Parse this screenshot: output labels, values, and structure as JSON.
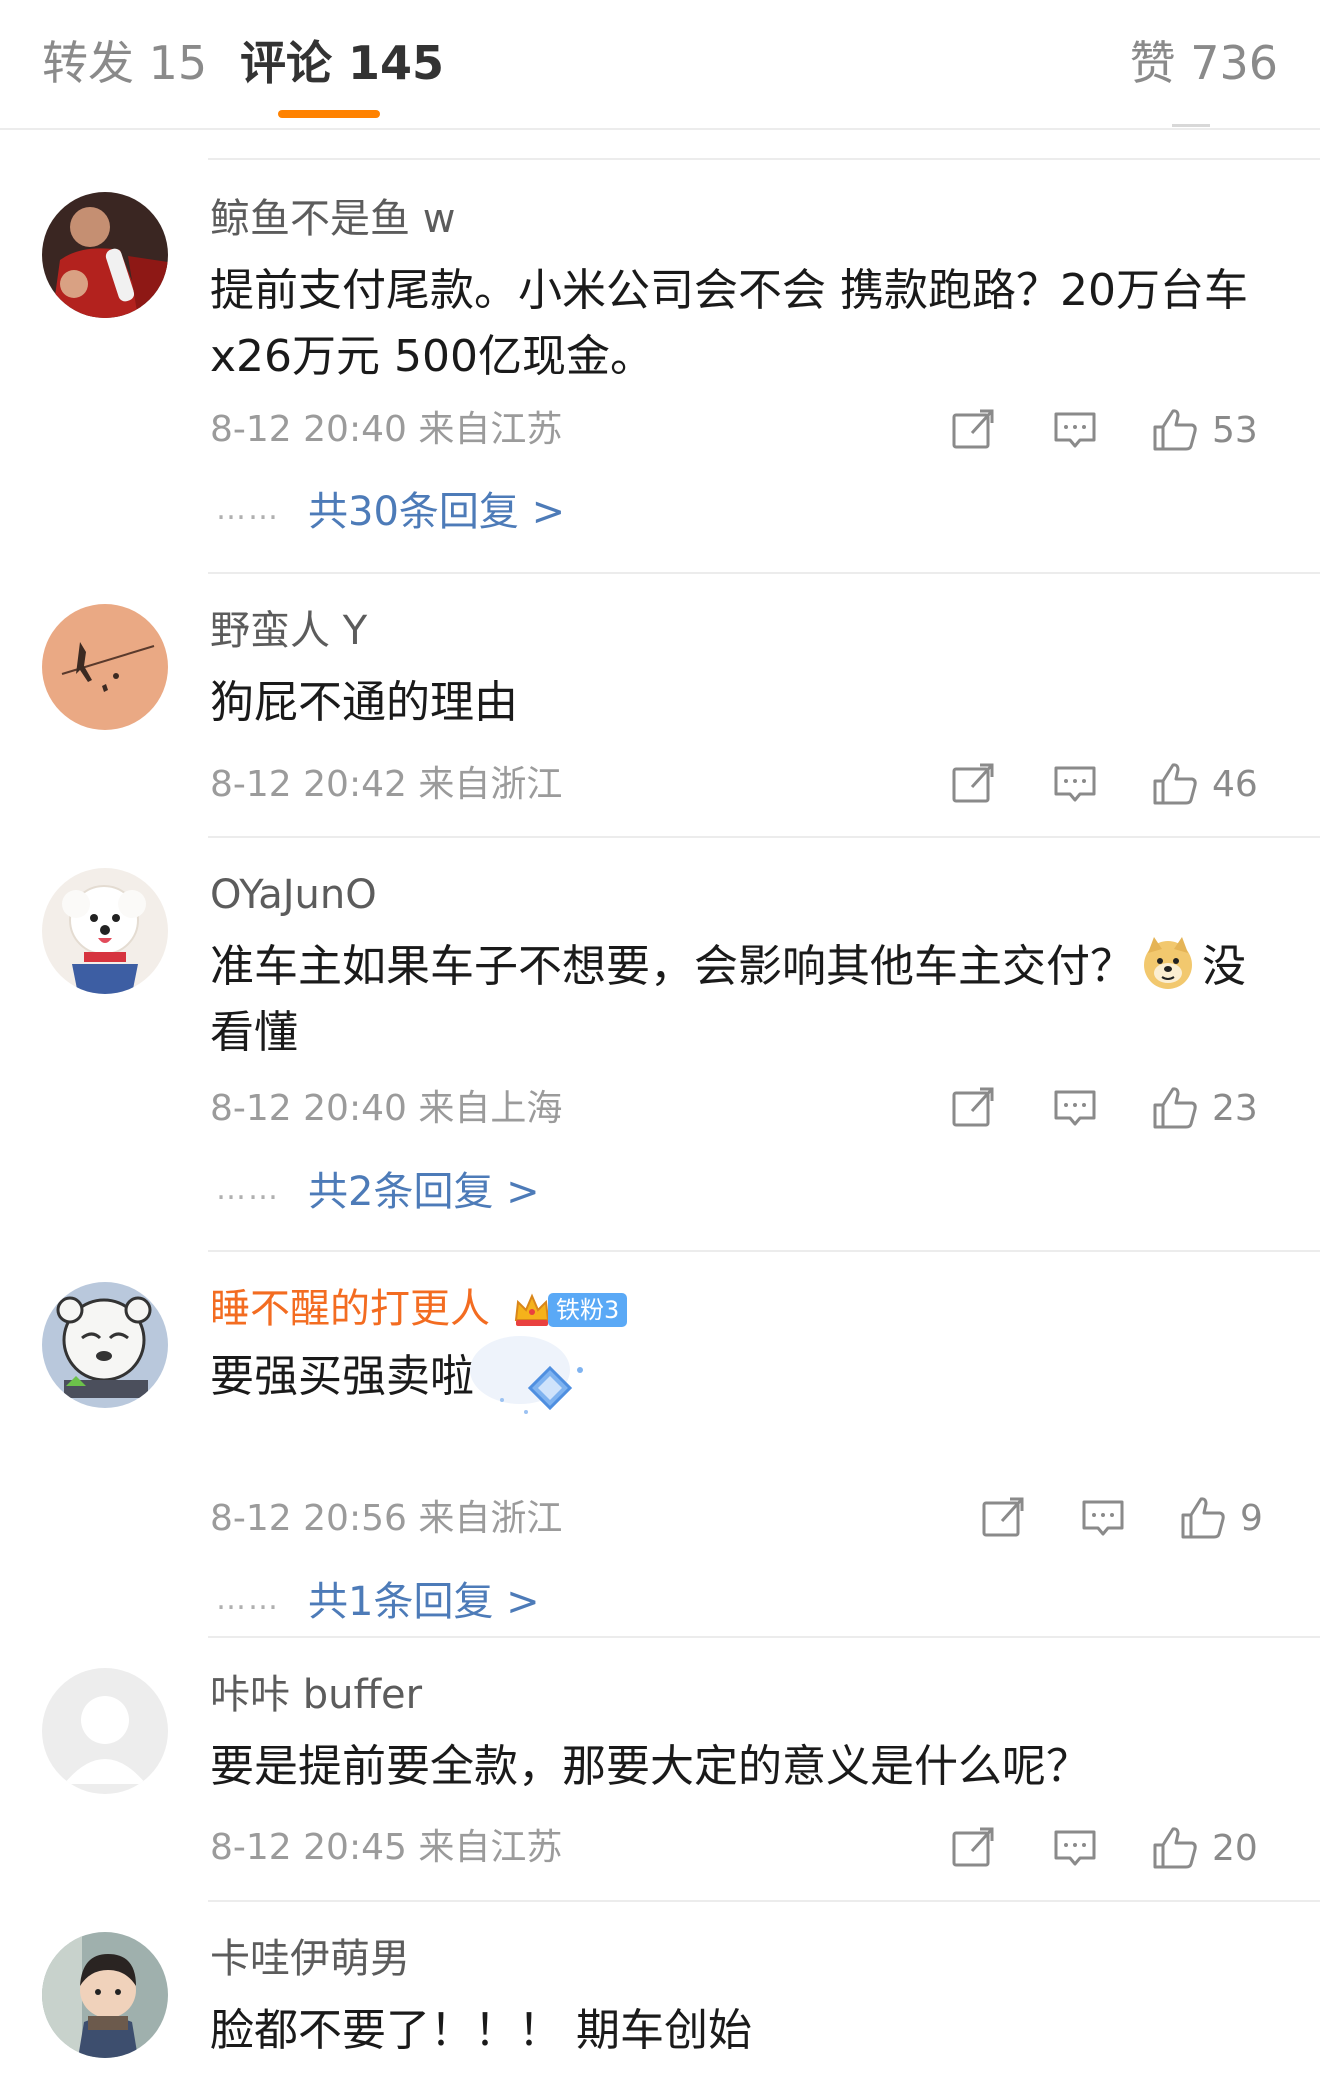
{
  "tabs": {
    "repost": "转发 15",
    "comments": "评论 145",
    "likes": "赞 736"
  },
  "colors": {
    "accent": "#ff8200",
    "link": "#4d7bb8",
    "vip_name": "#f36c21",
    "fan_badge": "#5aa9f6"
  },
  "icons": {
    "share": "share-icon",
    "reply": "comment-icon",
    "like": "thumbs-up-icon"
  },
  "comments": [
    {
      "user": "鲸鱼不是鱼 w",
      "text": "提前支付尾款。小米公司会不会 携款跑路？20万台车 x26万元  500亿现金。",
      "meta": "8-12 20:40 来自江苏",
      "likes": "53",
      "replies": "共30条回复 >",
      "dots": "……"
    },
    {
      "user": "野蛮人 Y",
      "text": "狗屁不通的理由",
      "meta": "8-12 20:42 来自浙江",
      "likes": "46"
    },
    {
      "user": "OYaJunO",
      "text_a": "准车主如果车子不想要，会影响其他车主交付？",
      "emoji": "doge-emoji",
      "text_b": "没看懂",
      "meta": "8-12 20:40 来自上海",
      "likes": "23",
      "replies": "共2条回复 >",
      "dots": "……"
    },
    {
      "user": "睡不醒的打更人",
      "fan_badge": "铁粉3",
      "text": "要强买强卖啦",
      "meta": "8-12 20:56 来自浙江",
      "likes": "9",
      "replies": "共1条回复 >",
      "dots": "……"
    },
    {
      "user": "咔咔 buffer",
      "text": "要是提前要全款，那要大定的意义是什么呢？",
      "meta": "8-12 20:45 来自江苏",
      "likes": "20"
    },
    {
      "user": "卡哇伊萌男",
      "text": "脸都不要了！！！ 期车创始"
    }
  ]
}
